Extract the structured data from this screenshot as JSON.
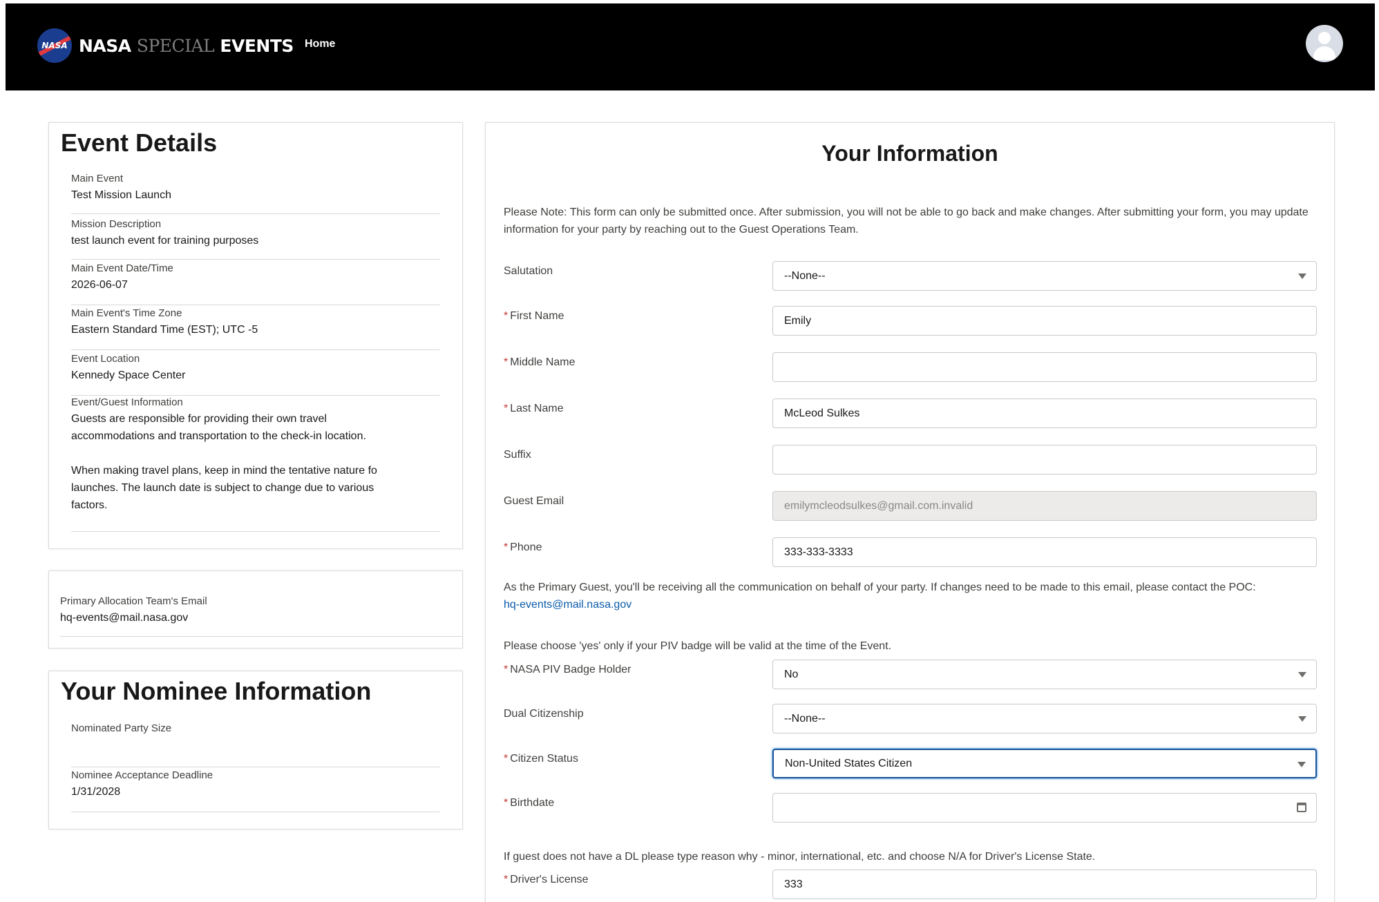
{
  "nav": {
    "brand_nasa": "NASA",
    "brand_special": "SPECIAL",
    "brand_events": "EVENTS",
    "logo_text": "NASA",
    "home": "Home",
    "avatar_icon": "user-avatar-icon"
  },
  "event_details": {
    "title": "Event Details",
    "fields": [
      {
        "label": "Main Event",
        "value": "Test Mission Launch"
      },
      {
        "label": "Mission Description",
        "value": "test launch event for training purposes"
      },
      {
        "label": "Main Event Date/Time",
        "value": "2026-06-07"
      },
      {
        "label": "Main Event's Time Zone",
        "value": "Eastern Standard Time (EST); UTC -5"
      },
      {
        "label": "Event Location",
        "value": "Kennedy Space Center"
      },
      {
        "label": "Event/Guest Information",
        "value": "Guests are responsible for providing their own travel\naccommodations and transportation to the check-in location.\n\nWhen making travel plans, keep in mind the tentative nature fo\nlaunches. The launch date is subject to change due to various\nfactors."
      }
    ]
  },
  "allocation": {
    "label": "Primary Allocation Team's Email",
    "value": "hq-events@mail.nasa.gov"
  },
  "nominee": {
    "title": "Your Nominee Information",
    "party_size_label": "Nominated Party Size",
    "party_size_value": "",
    "deadline_label": "Nominee Acceptance Deadline",
    "deadline_value": "1/31/2028"
  },
  "info": {
    "title": "Your Information",
    "note_top": "Please Note: This form can only be submitted once. After submission, you will not be able to go back and make changes. After submitting your form, you may update information for your party by reaching out to the Guest Operations Team.",
    "salutation_label": "Salutation",
    "salutation_value": "--None--",
    "first_name_label": "First Name",
    "first_name_value": "Emily",
    "middle_name_label": "Middle Name",
    "middle_name_value": "",
    "last_name_label": "Last Name",
    "last_name_value": "McLeod Sulkes",
    "suffix_label": "Suffix",
    "suffix_value": "",
    "guest_email_label": "Guest Email",
    "guest_email_value": "emilymcleodsulkes@gmail.com.invalid",
    "phone_label": "Phone",
    "phone_value": "333-333-3333",
    "primary_note": "As the Primary Guest, you'll be receiving all the communication on behalf of your party. If changes need to be made to this email, please contact the POC:",
    "poc_email": "hq-events@mail.nasa.gov",
    "piv_note": "Please choose 'yes' only if your PIV badge will be valid at the time of the Event.",
    "piv_label": "NASA PIV Badge Holder",
    "piv_value": "No",
    "dual_label": "Dual Citizenship",
    "dual_value": "--None--",
    "citizen_label": "Citizen Status",
    "citizen_value": "Non-United States Citizen",
    "birthdate_label": "Birthdate",
    "birthdate_value": "",
    "dl_note": "If guest does not have a DL please type reason why - minor, international, etc. and choose N/A for Driver's License State.",
    "dl_label": "Driver's License",
    "dl_value": "333",
    "required_mark": "*"
  }
}
